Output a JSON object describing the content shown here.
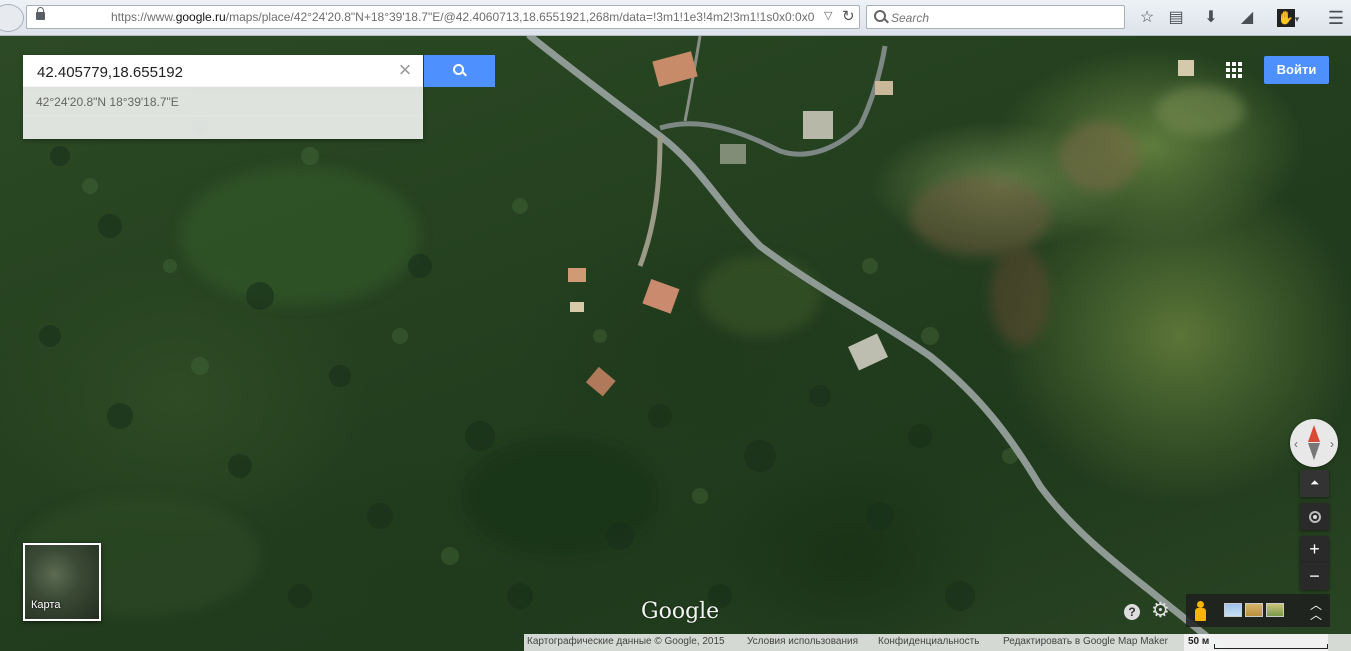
{
  "browser": {
    "url_prefix": "https://www.",
    "url_domain": "google.ru",
    "url_path": "/maps/place/42°24'20.8\"N+18°39'18.7\"E/@42.4060713,18.6551921,268m/data=!3m1!1e3!4m2!3m1!1s0x0:0x0",
    "search_placeholder": "Search"
  },
  "maps": {
    "search_value": "42.405779,18.655192",
    "suggestion": "42°24'20.8\"N 18°39'18.7\"E",
    "signin_label": "Войти",
    "minimap_label": "Карта",
    "logo": "Google",
    "help": "?",
    "zoom_in": "+",
    "zoom_out": "−",
    "scale_label": "50 м",
    "footer": {
      "copyright": "Картографические данные © Google, 2015",
      "terms": "Условия использования",
      "privacy": "Конфиденциальность",
      "mapmaker": "Редактировать в Google Map Maker"
    }
  },
  "colors": {
    "accent_blue": "#4d90fe",
    "vegetation": "#24401f",
    "road": "#8f9a95"
  }
}
